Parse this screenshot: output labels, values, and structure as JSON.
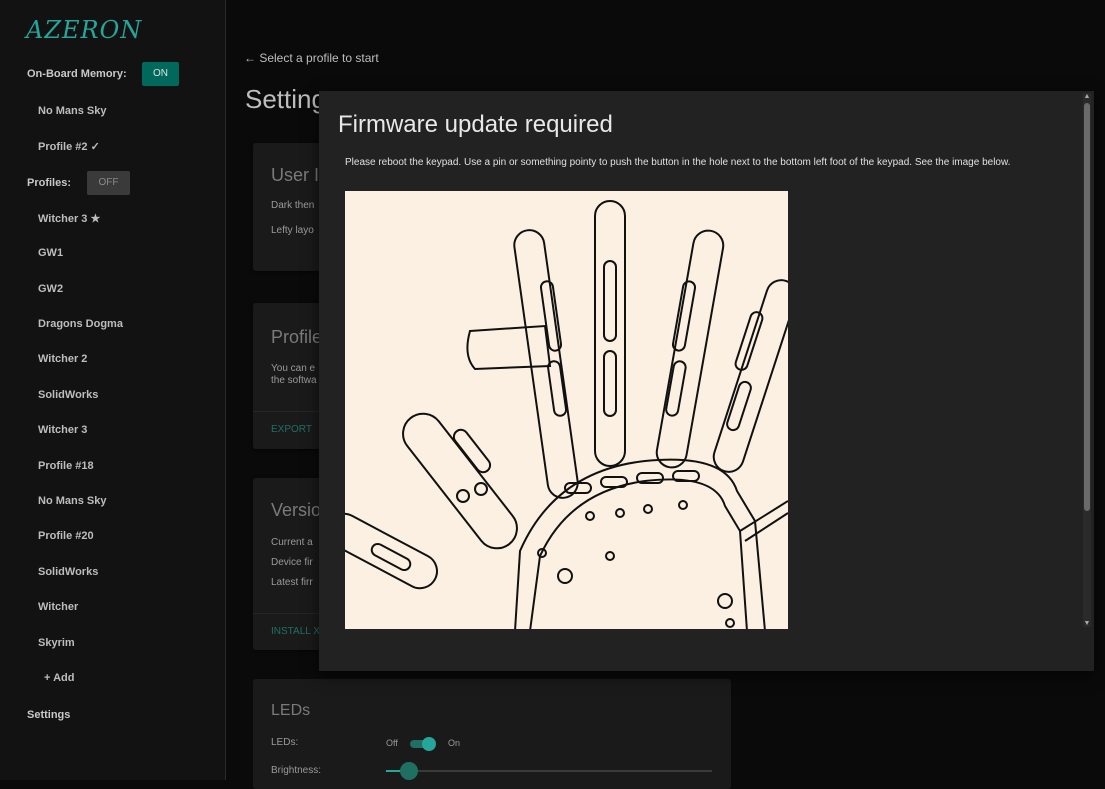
{
  "sidebar": {
    "logo": "AZERON",
    "onboard_label": "On-Board Memory:",
    "onboard_toggle": "ON",
    "onboard_items": [
      "No Mans Sky",
      "Profile #2 ✓"
    ],
    "profiles_label": "Profiles:",
    "profiles_toggle": "OFF",
    "profile_items": [
      "Witcher 3 ★",
      "GW1",
      "GW2",
      "Dragons Dogma",
      "Witcher 2",
      "SolidWorks",
      "Witcher 3",
      "Profile #18",
      "No Mans Sky",
      "Profile #20",
      "SolidWorks",
      "Witcher",
      "Skyrim"
    ],
    "add_label": "+ Add",
    "settings_label": "Settings"
  },
  "main": {
    "back_text": "← Select a profile to start",
    "title": "Setting",
    "user_card": {
      "title": "User Ir",
      "line1": "Dark then",
      "line2": "Lefty layo"
    },
    "profile_card": {
      "title": "Profile",
      "line1": "You can e",
      "line2": "the softwa",
      "action": "EXPORT"
    },
    "version_card": {
      "title": "Versio",
      "line1": "Current a",
      "line2": "Device fir",
      "line3": "Latest firr",
      "action": "INSTALL X"
    },
    "leds_card": {
      "title": "LEDs",
      "leds_label": "LEDs:",
      "off": "Off",
      "on": "On",
      "brightness_label": "Brightness:",
      "brightness_value": 0.1
    }
  },
  "modal": {
    "title": "Firmware update required",
    "text": "Please reboot the keypad. Use a pin or something pointy to push the button in the hole next to the bottom left foot of the keypad. See the image below."
  },
  "colors": {
    "accent": "#26a69a",
    "modal_bg": "#222222",
    "image_bg": "#fbf0e2"
  }
}
